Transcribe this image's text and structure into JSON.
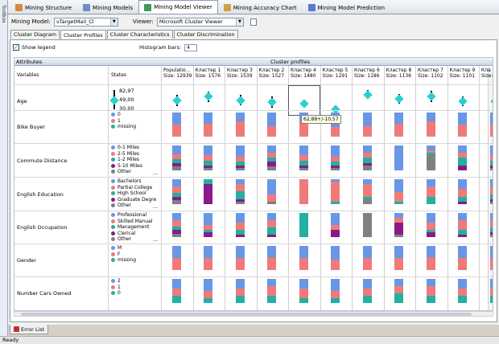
{
  "toolbox": {
    "label": "Toolbox"
  },
  "tabs": [
    {
      "label": "Mining Structure",
      "icon": "structure-icon",
      "color": "#d48b3a"
    },
    {
      "label": "Mining Models",
      "icon": "models-icon",
      "color": "#6c8cc8"
    },
    {
      "label": "Mining Model Viewer",
      "icon": "viewer-icon",
      "color": "#3c9a5a",
      "active": true
    },
    {
      "label": "Mining Accuracy Chart",
      "icon": "accuracy-chart-icon",
      "color": "#d4a040"
    },
    {
      "label": "Mining Model Prediction",
      "icon": "prediction-icon",
      "color": "#5a7ad0"
    }
  ],
  "toolbar": {
    "model_label": "Mining Model:",
    "model_value": "vTargetMail_Cl",
    "viewer_label": "Viewer:",
    "viewer_value": "Microsoft Cluster Viewer"
  },
  "subtabs": [
    "Cluster Diagram",
    "Cluster Profiles",
    "Cluster Characteristics",
    "Cluster Discrimination"
  ],
  "subtab_active": 1,
  "panel": {
    "show_legend": "Show legend",
    "histogram_label": "Histogram bars:",
    "histogram_value": "4"
  },
  "grid": {
    "header_attributes": "Attributes",
    "header_profiles": "Cluster profiles",
    "col_variables": "Variables",
    "col_states": "States",
    "columns": [
      {
        "name": "Populatio...",
        "size": "Size: 12939"
      },
      {
        "name": "Кластер 1",
        "size": "Size: 1576"
      },
      {
        "name": "Кластер 3",
        "size": "Size: 1539"
      },
      {
        "name": "Кластер 2",
        "size": "Size: 1527"
      },
      {
        "name": "Кластер 4",
        "size": "Size: 1480"
      },
      {
        "name": "Кластер 5",
        "size": "Size: 1291"
      },
      {
        "name": "Кластер 6",
        "size": "Size: 1186"
      },
      {
        "name": "Кластер 8",
        "size": "Size: 1136"
      },
      {
        "name": "Кластер 7",
        "size": "Size: 1102"
      },
      {
        "name": "Кластер 9",
        "size": "Size: 1101"
      },
      {
        "name": "Кла",
        "size": "Size:"
      }
    ],
    "rows": [
      {
        "variable": "Age",
        "type": "gauge",
        "legend": [
          "82,97",
          "49,00",
          "30,00"
        ],
        "gauge_mean": [
          0.55,
          0.7,
          0.55,
          0.45,
          0.4,
          0.15,
          0.8,
          0.6,
          0.7,
          0.5,
          0.5
        ],
        "gauge_spread": [
          0.5,
          0.45,
          0.45,
          0.5,
          0.2,
          0.35,
          0.4,
          0.45,
          0.5,
          0.45,
          0.4
        ]
      },
      {
        "variable": "Bike Buyer",
        "type": "hist",
        "legend": [
          {
            "label": "0",
            "color": "#6a96e6"
          },
          {
            "label": "1",
            "color": "#f07a7a"
          },
          {
            "label": "missing",
            "color": "#22b0a0"
          }
        ],
        "values": [
          [
            0.5,
            0.5,
            0
          ],
          [
            0.45,
            0.55,
            0
          ],
          [
            0.35,
            0.65,
            0
          ],
          [
            0.55,
            0.45,
            0
          ],
          [
            0.4,
            0.6,
            0
          ],
          [
            0.6,
            0.4,
            0
          ],
          [
            0.55,
            0.45,
            0
          ],
          [
            0.45,
            0.55,
            0
          ],
          [
            0.35,
            0.65,
            0
          ],
          [
            0.5,
            0.5,
            0
          ],
          [
            0.5,
            0.5,
            0
          ]
        ]
      },
      {
        "variable": "Commute Distance",
        "type": "hist",
        "legend": [
          {
            "label": "0-1 Miles",
            "color": "#6a96e6"
          },
          {
            "label": "2-5 Miles",
            "color": "#f07a7a"
          },
          {
            "label": "1-2 Miles",
            "color": "#22b0a0"
          },
          {
            "label": "5-10 Miles",
            "color": "#8a1a8a"
          },
          {
            "label": "Other",
            "color": "#808080"
          }
        ],
        "values": [
          [
            0.35,
            0.2,
            0.15,
            0.15,
            0.15
          ],
          [
            0.4,
            0.2,
            0.2,
            0.1,
            0.1
          ],
          [
            0.45,
            0.2,
            0.15,
            0.1,
            0.1
          ],
          [
            0.3,
            0.2,
            0.15,
            0.2,
            0.15
          ],
          [
            0.4,
            0.2,
            0.2,
            0.1,
            0.1
          ],
          [
            0.45,
            0.2,
            0.15,
            0.1,
            0.1
          ],
          [
            0.3,
            0.2,
            0.2,
            0.1,
            0.2
          ],
          [
            1,
            0,
            0,
            0,
            0
          ],
          [
            0.2,
            0.1,
            0.1,
            0,
            0.6
          ],
          [
            0.3,
            0.2,
            0.3,
            0.2,
            0
          ],
          [
            0.4,
            0.2,
            0.2,
            0.1,
            0.1
          ]
        ]
      },
      {
        "variable": "English Education",
        "type": "hist",
        "legend": [
          {
            "label": "Bachelors",
            "color": "#6a96e6"
          },
          {
            "label": "Partial College",
            "color": "#f07a7a"
          },
          {
            "label": "High School",
            "color": "#22b0a0"
          },
          {
            "label": "Graduate Degre",
            "color": "#8a1a8a"
          },
          {
            "label": "Other",
            "color": "#808080"
          }
        ],
        "values": [
          [
            0.3,
            0.25,
            0.15,
            0.15,
            0.15
          ],
          [
            0,
            0,
            0.2,
            0.8,
            0
          ],
          [
            0.2,
            0.3,
            0.3,
            0.1,
            0.1
          ],
          [
            0.6,
            0.3,
            0,
            0,
            0.1
          ],
          [
            0,
            1,
            0,
            0,
            0
          ],
          [
            0.1,
            0.8,
            0.1,
            0,
            0
          ],
          [
            0.2,
            0.5,
            0.1,
            0,
            0.2
          ],
          [
            0.5,
            0.4,
            0.1,
            0,
            0
          ],
          [
            0.3,
            0.4,
            0.3,
            0,
            0
          ],
          [
            0.4,
            0.3,
            0.2,
            0.1,
            0
          ],
          [
            0.3,
            0.3,
            0.2,
            0.1,
            0.1
          ]
        ]
      },
      {
        "variable": "English Occupation",
        "type": "hist",
        "legend": [
          {
            "label": "Professional",
            "color": "#6a96e6"
          },
          {
            "label": "Skilled Manual",
            "color": "#f07a7a"
          },
          {
            "label": "Management",
            "color": "#22b0a0"
          },
          {
            "label": "Clerical",
            "color": "#8a1a8a"
          },
          {
            "label": "Other",
            "color": "#808080"
          }
        ],
        "values": [
          [
            0.3,
            0.25,
            0.15,
            0.15,
            0.15
          ],
          [
            0.5,
            0.2,
            0.1,
            0.2,
            0
          ],
          [
            0.4,
            0.3,
            0.2,
            0.1,
            0
          ],
          [
            0.3,
            0.3,
            0.3,
            0.1,
            0
          ],
          [
            0,
            0,
            1,
            0,
            0
          ],
          [
            0.5,
            0.2,
            0,
            0.3,
            0
          ],
          [
            0,
            0,
            0,
            0,
            1
          ],
          [
            0.2,
            0.2,
            0,
            0.5,
            0.1
          ],
          [
            0.4,
            0.3,
            0.1,
            0.2,
            0
          ],
          [
            0.3,
            0.4,
            0.2,
            0.1,
            0
          ],
          [
            0.3,
            0.3,
            0.2,
            0.1,
            0.1
          ]
        ]
      },
      {
        "variable": "Gender",
        "type": "hist",
        "legend": [
          {
            "label": "M",
            "color": "#6a96e6"
          },
          {
            "label": "F",
            "color": "#f07a7a"
          },
          {
            "label": "missing",
            "color": "#22b0a0"
          }
        ],
        "values": [
          [
            0.5,
            0.5,
            0
          ],
          [
            0.5,
            0.5,
            0
          ],
          [
            0.5,
            0.5,
            0
          ],
          [
            0.45,
            0.55,
            0
          ],
          [
            0.5,
            0.5,
            0
          ],
          [
            0.55,
            0.45,
            0
          ],
          [
            0.5,
            0.5,
            0
          ],
          [
            0.5,
            0.5,
            0
          ],
          [
            0.45,
            0.55,
            0
          ],
          [
            0.5,
            0.5,
            0
          ],
          [
            0.5,
            0.5,
            0
          ]
        ]
      },
      {
        "variable": "Number Cars Owned",
        "type": "hist",
        "legend": [
          {
            "label": "2",
            "color": "#6a96e6"
          },
          {
            "label": "1",
            "color": "#f07a7a"
          },
          {
            "label": "0",
            "color": "#22b0a0"
          }
        ],
        "values": [
          [
            0.4,
            0.3,
            0.3
          ],
          [
            0.5,
            0.3,
            0.2
          ],
          [
            0.4,
            0.3,
            0.3
          ],
          [
            0.3,
            0.4,
            0.3
          ],
          [
            0.4,
            0.4,
            0.2
          ],
          [
            0.5,
            0.3,
            0.2
          ],
          [
            0.4,
            0.3,
            0.3
          ],
          [
            0.3,
            0.3,
            0.4
          ],
          [
            0.3,
            0.4,
            0.3
          ],
          [
            0.4,
            0.3,
            0.3
          ],
          [
            0.4,
            0.3,
            0.3
          ]
        ]
      }
    ]
  },
  "tooltip": "62,88+/-10,57",
  "error_tab": "Error List",
  "status": "Ready"
}
